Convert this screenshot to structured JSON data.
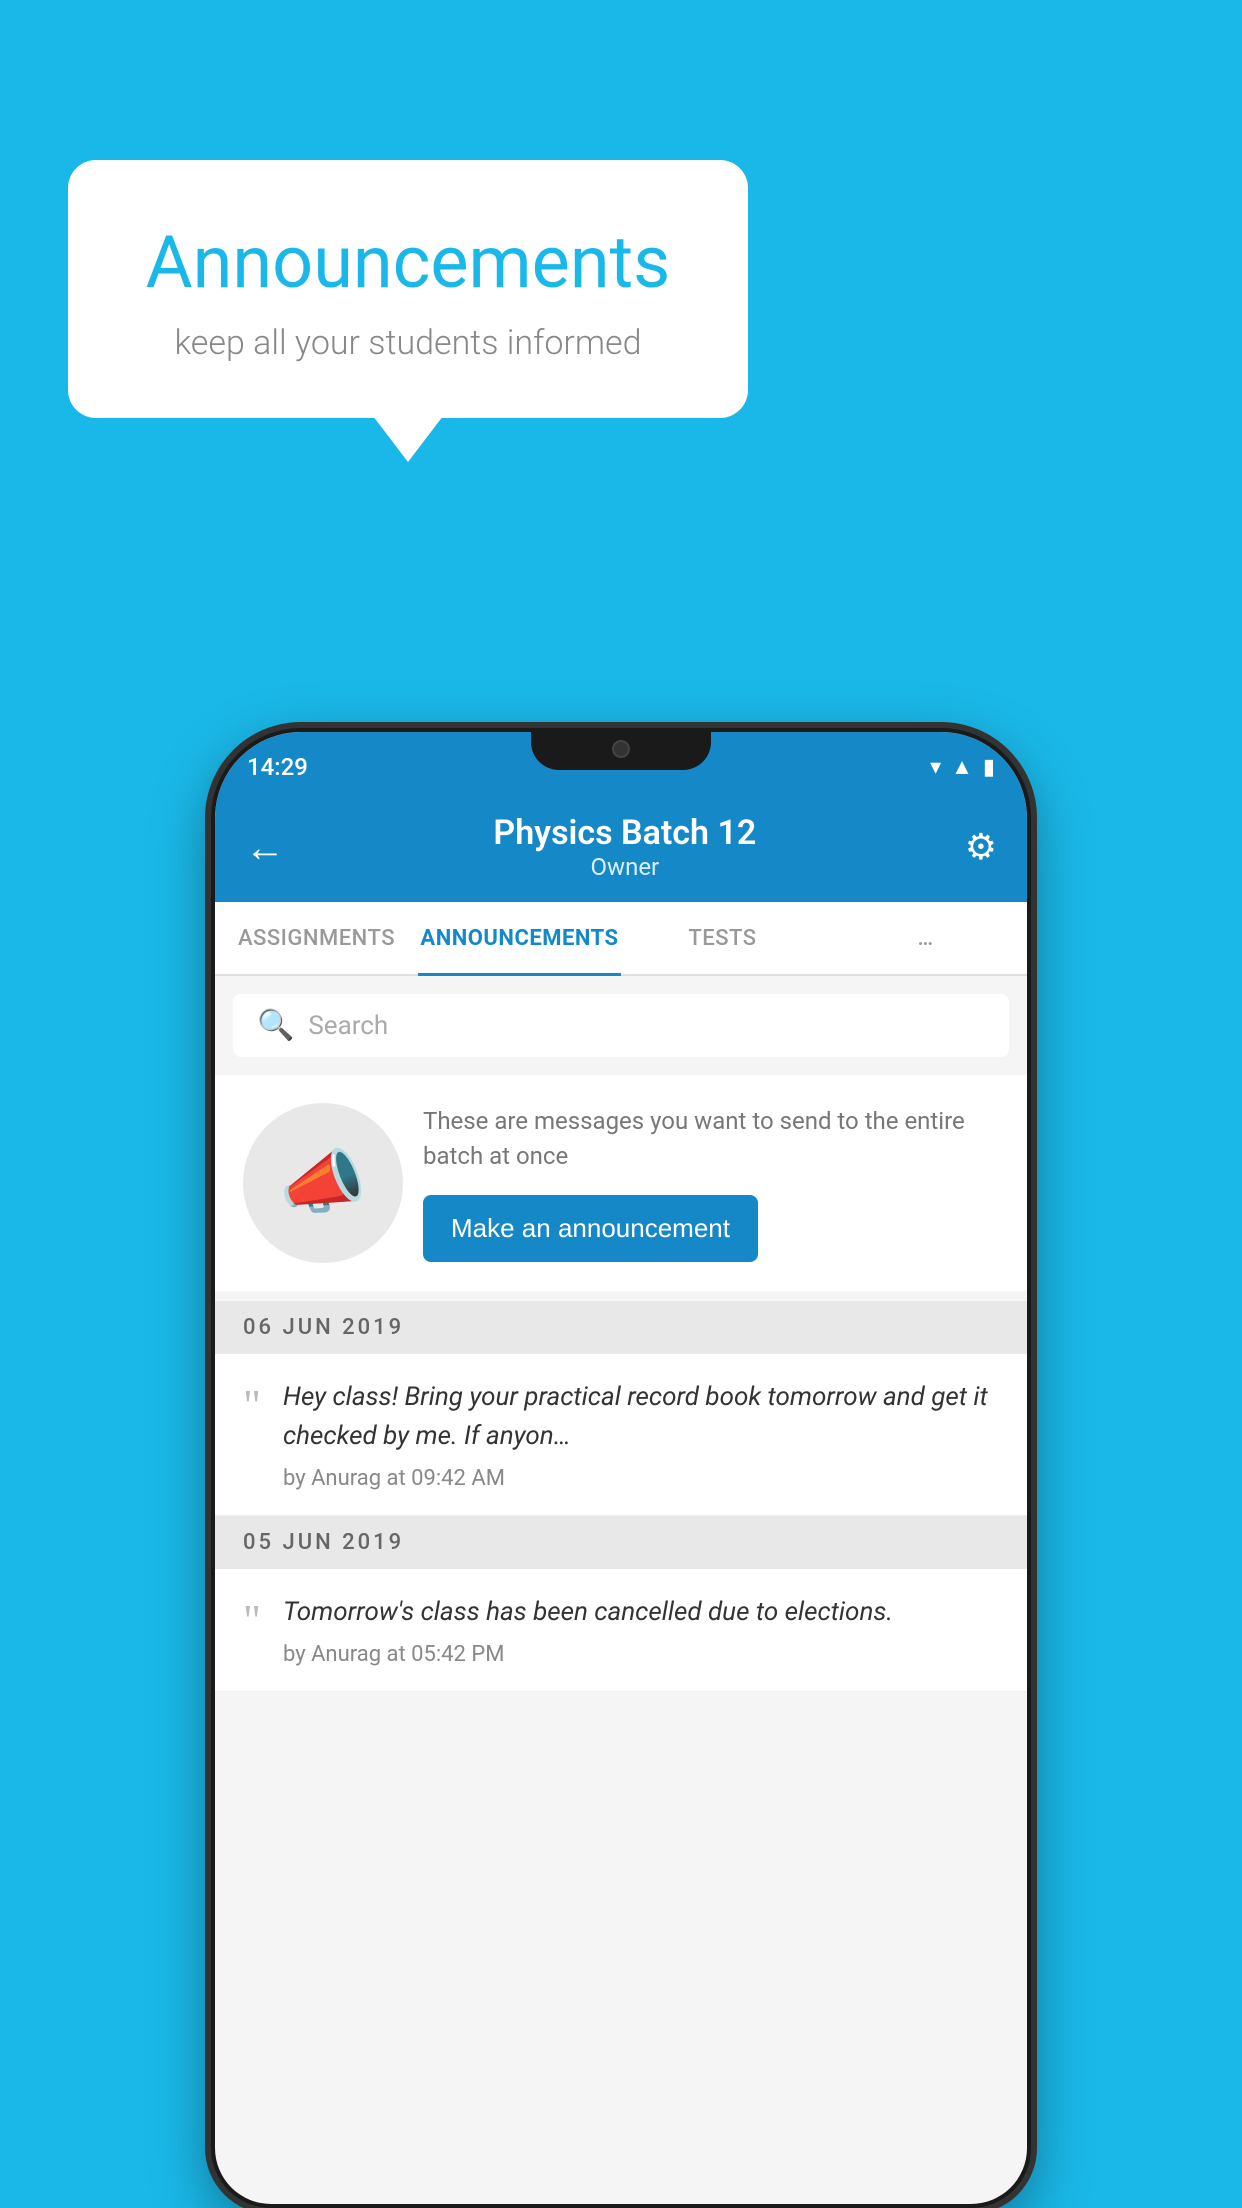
{
  "page": {
    "background_color": "#1ab8e8"
  },
  "speech_bubble": {
    "title": "Announcements",
    "subtitle": "keep all your students informed"
  },
  "phone": {
    "status_bar": {
      "time": "14:29"
    },
    "header": {
      "title": "Physics Batch 12",
      "subtitle": "Owner",
      "back_label": "←",
      "settings_label": "⚙"
    },
    "tabs": [
      {
        "label": "ASSIGNMENTS",
        "active": false
      },
      {
        "label": "ANNOUNCEMENTS",
        "active": true
      },
      {
        "label": "TESTS",
        "active": false
      },
      {
        "label": "…",
        "active": false
      }
    ],
    "search": {
      "placeholder": "Search"
    },
    "promo_card": {
      "description": "These are messages you want to send to the entire batch at once",
      "button_label": "Make an announcement"
    },
    "announcements": [
      {
        "date": "06  JUN  2019",
        "text": "Hey class! Bring your practical record book tomorrow and get it checked by me. If anyon…",
        "meta": "by Anurag at 09:42 AM"
      },
      {
        "date": "05  JUN  2019",
        "text": "Tomorrow's class has been cancelled due to elections.",
        "meta": "by Anurag at 05:42 PM"
      }
    ]
  }
}
